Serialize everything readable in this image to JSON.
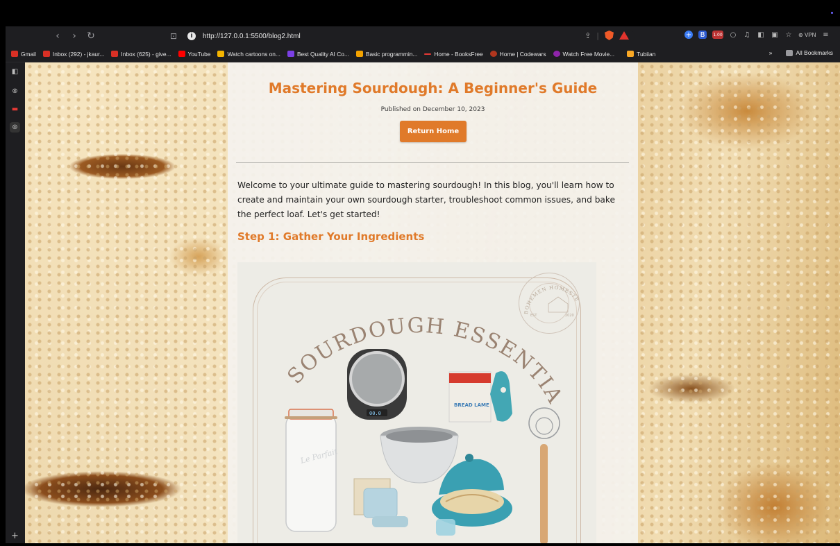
{
  "browser": {
    "url": "http://127.0.0.1:5500/blog2.html",
    "vpn_label": "VPN",
    "badge": "1.00"
  },
  "bookmarks": [
    {
      "label": "Gmail",
      "color": "#d93025"
    },
    {
      "label": "Inbox (292) - jkaur...",
      "color": "#d93025"
    },
    {
      "label": "Inbox (625) - give...",
      "color": "#d93025"
    },
    {
      "label": "YouTube",
      "color": "#ff0000"
    },
    {
      "label": "Watch cartoons on...",
      "color": "#f4b400"
    },
    {
      "label": "Best Quality AI Co...",
      "color": "#7b3fe4"
    },
    {
      "label": "Basic programmin...",
      "color": "#f4a300"
    },
    {
      "label": "Home - BooksFree",
      "color": "#e53935"
    },
    {
      "label": "Home | Codewars",
      "color": "#b1361e"
    },
    {
      "label": "Watch Free Movie...",
      "color": "#8e24aa"
    },
    {
      "label": "Tubiian",
      "color": "#f9a825"
    }
  ],
  "bookmarks_more": "»",
  "all_bookmarks": "All Bookmarks",
  "blog": {
    "title": "Mastering Sourdough: A Beginner's Guide",
    "published": "Published on December 10, 2023",
    "return_button": "Return Home",
    "intro": "Welcome to your ultimate guide to mastering sourdough! In this blog, you'll learn how to create and maintain your own sourdough starter, troubleshoot common issues, and bake the perfect loaf. Let's get started!",
    "step1_heading": "Step 1: Gather Your Ingredients",
    "image": {
      "heading": "SOURDOUGH ESSENTIALS",
      "stamp_text": "BOHEMEN HOMESTEAD",
      "stamp_years": [
        "EST",
        "2020"
      ],
      "scale_display": "00.0",
      "lame_brand": "BREAD LAME"
    }
  }
}
